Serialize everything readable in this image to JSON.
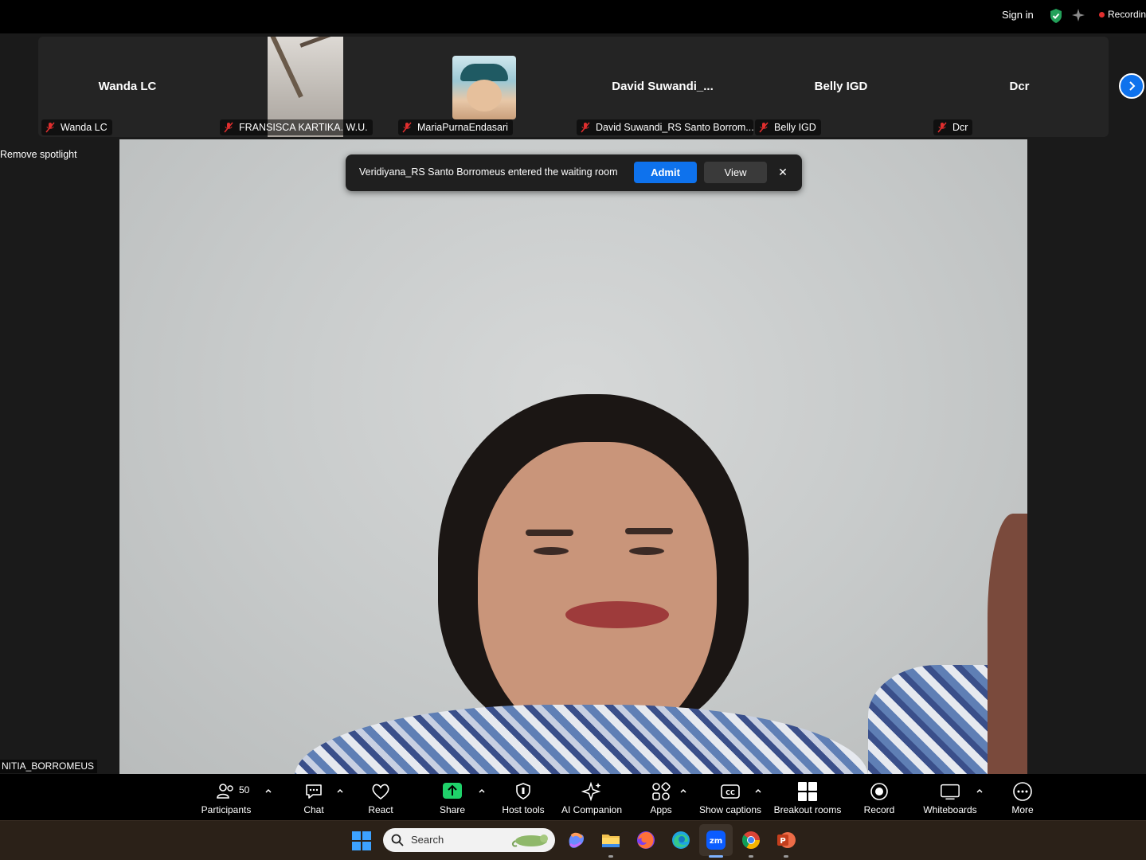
{
  "topbar": {
    "sign_in": "Sign in",
    "recording_label": "Recordin"
  },
  "filmstrip": {
    "tiles": [
      {
        "big_name": "Wanda LC",
        "tag": "Wanda LC"
      },
      {
        "big_name": "",
        "tag": "FRANSISCA KARTIKA. W.U."
      },
      {
        "big_name": "",
        "tag": "MariaPurnaEndasari"
      },
      {
        "big_name": "David  Suwandi_...",
        "tag": "David Suwandi_RS Santo Borrom..."
      },
      {
        "big_name": "Belly IGD",
        "tag": "Belly IGD"
      },
      {
        "big_name": "Dcr",
        "tag": "Dcr"
      }
    ]
  },
  "sidebar": {
    "remove_spotlight": "Remove spotlight",
    "spotlight_name_tag": "NITIA_BORROMEUS"
  },
  "notification": {
    "message": "Veridiyana_RS Santo Borromeus entered the waiting room",
    "admit": "Admit",
    "view": "View",
    "close": "✕"
  },
  "toolbar": {
    "participants_count": "50",
    "participants": "Participants",
    "chat": "Chat",
    "react": "React",
    "share": "Share",
    "host_tools": "Host tools",
    "ai_companion": "AI Companion",
    "apps": "Apps",
    "show_captions": "Show captions",
    "breakout_rooms": "Breakout rooms",
    "record": "Record",
    "whiteboards": "Whiteboards",
    "more": "More"
  },
  "taskbar": {
    "search_placeholder": "Search"
  },
  "colors": {
    "accent": "#0e72ed",
    "share_green": "#1fd16a",
    "recording_red": "#e02e2e",
    "shield_green": "#23a15a"
  }
}
